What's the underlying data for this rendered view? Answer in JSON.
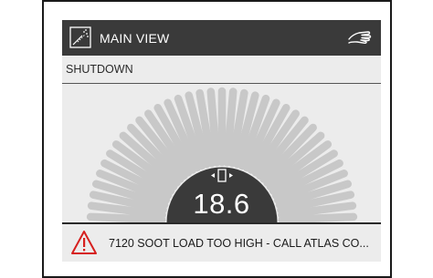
{
  "header": {
    "title": "MAIN VIEW",
    "left_icon": "screen-corner-icon",
    "right_icon": "hand-icon"
  },
  "status": {
    "text": "SHUTDOWN"
  },
  "gauge": {
    "value": "18.6",
    "symbol_icon": "pressure-sensor-icon",
    "segment_count": 37
  },
  "alarm": {
    "icon": "warning-triangle-icon",
    "text": "7120  SOOT LOAD TOO HIGH - CALL ATLAS CO..."
  },
  "colors": {
    "title_bar": "#3a3a3a",
    "background": "#ececec",
    "gauge_segment": "#c8c8c8",
    "gauge_center": "#3a3a3a",
    "alarm_red": "#d6201f"
  }
}
